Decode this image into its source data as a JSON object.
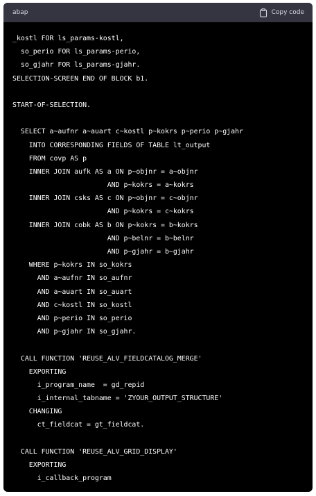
{
  "code_block": {
    "language": "abap",
    "copy_label": "Copy code",
    "lines": [
      "_kostl FOR ls_params-kostl,",
      "  so_perio FOR ls_params-perio,",
      "  so_gjahr FOR ls_params-gjahr.",
      "SELECTION-SCREEN END OF BLOCK b1.",
      "",
      "START-OF-SELECTION.",
      "",
      "  SELECT a~aufnr a~auart c~kostl p~kokrs p~perio p~gjahr",
      "    INTO CORRESPONDING FIELDS OF TABLE lt_output",
      "    FROM covp AS p",
      "    INNER JOIN aufk AS a ON p~objnr = a~objnr",
      "                       AND p~kokrs = a~kokrs",
      "    INNER JOIN csks AS c ON p~objnr = c~objnr",
      "                       AND p~kokrs = c~kokrs",
      "    INNER JOIN cobk AS b ON p~kokrs = b~kokrs",
      "                       AND p~belnr = b~belnr",
      "                       AND p~gjahr = b~gjahr",
      "    WHERE p~kokrs IN so_kokrs",
      "      AND a~aufnr IN so_aufnr",
      "      AND a~auart IN so_auart",
      "      AND c~kostl IN so_kostl",
      "      AND p~perio IN so_perio",
      "      AND p~gjahr IN so_gjahr.",
      "",
      "  CALL FUNCTION 'REUSE_ALV_FIELDCATALOG_MERGE'",
      "    EXPORTING",
      "      i_program_name  = gd_repid",
      "      i_internal_tabname = 'ZYOUR_OUTPUT_STRUCTURE'",
      "    CHANGING",
      "      ct_fieldcat = gt_fieldcat.",
      "",
      "  CALL FUNCTION 'REUSE_ALV_GRID_DISPLAY'",
      "    EXPORTING",
      "      i_callback_program"
    ]
  },
  "colors": {
    "header_bg": "#343541",
    "code_bg": "#000000",
    "text": "#ffffff",
    "header_text": "#d9d9e3"
  },
  "icons": {
    "copy": "clipboard-icon"
  }
}
